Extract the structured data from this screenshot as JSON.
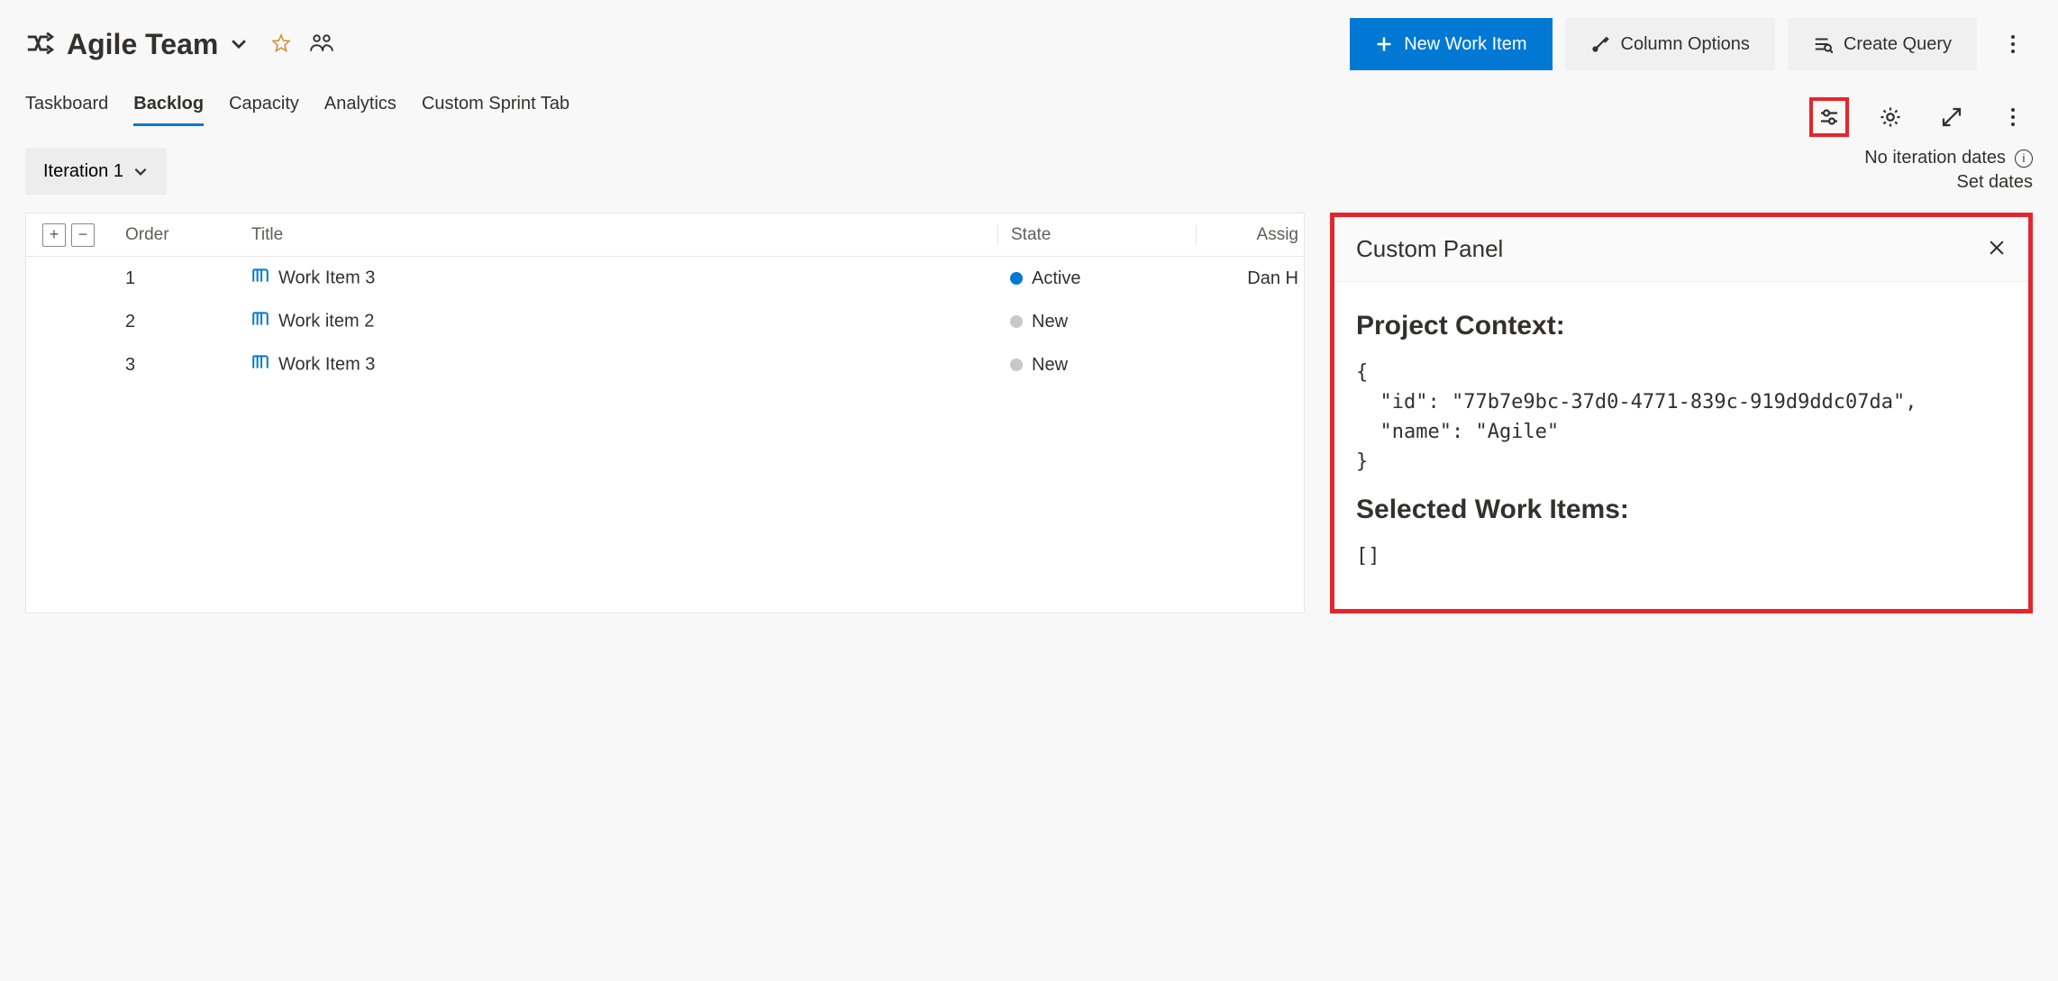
{
  "header": {
    "team_name": "Agile Team",
    "buttons": {
      "new_work_item": "New Work Item",
      "column_options": "Column Options",
      "create_query": "Create Query"
    }
  },
  "tabs": [
    {
      "label": "Taskboard",
      "active": false
    },
    {
      "label": "Backlog",
      "active": true
    },
    {
      "label": "Capacity",
      "active": false
    },
    {
      "label": "Analytics",
      "active": false
    },
    {
      "label": "Custom Sprint Tab",
      "active": false
    }
  ],
  "iteration": {
    "label": "Iteration 1",
    "no_dates": "No iteration dates",
    "set_dates": "Set dates"
  },
  "grid": {
    "columns": {
      "order": "Order",
      "title": "Title",
      "state": "State",
      "assigned": "Assigned To"
    },
    "rows": [
      {
        "order": "1",
        "title": "Work Item 3",
        "state": "Active",
        "state_kind": "active",
        "assigned": "Dan H"
      },
      {
        "order": "2",
        "title": "Work item 2",
        "state": "New",
        "state_kind": "new",
        "assigned": ""
      },
      {
        "order": "3",
        "title": "Work Item 3",
        "state": "New",
        "state_kind": "new",
        "assigned": ""
      }
    ]
  },
  "panel": {
    "title": "Custom Panel",
    "h1": "Project Context:",
    "json1": "{\n  \"id\": \"77b7e9bc-37d0-4771-839c-919d9ddc07da\",\n  \"name\": \"Agile\"\n}",
    "h2": "Selected Work Items:",
    "json2": "[]"
  }
}
